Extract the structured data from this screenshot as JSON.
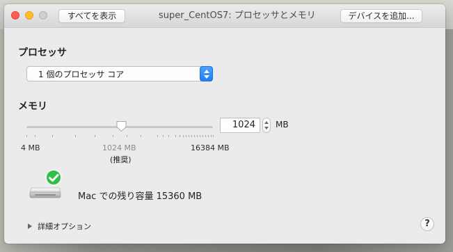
{
  "window": {
    "title": "super_CentOS7: プロセッサとメモリ"
  },
  "toolbar": {
    "show_all_label": "すべてを表示",
    "add_device_label": "デバイスを追加..."
  },
  "processor": {
    "heading": "プロセッサ",
    "selected_value": "1 個のプロセッサ コア"
  },
  "memory": {
    "heading": "メモリ",
    "value": "1024",
    "unit": "MB",
    "slider_level_fraction": 0.5,
    "min_label": "4 MB",
    "current_label": "1024 MB",
    "recommended_label": "(推奨)",
    "max_label": "16384 MB"
  },
  "status": {
    "capacity_text": "Mac での残り容量 15360 MB"
  },
  "details": {
    "label": "詳細オプション"
  },
  "help": {
    "label": "?"
  },
  "icons": {
    "select_stepper": "chevron-up-down-icon",
    "memory_stepper": "stepper-icon",
    "mac_icon": "mac-mini-icon",
    "check_icon": "check-icon",
    "disclosure_icon": "triangle-right-icon",
    "help_icon": "help-icon"
  },
  "colors": {
    "accent_blue": "#1f7ef3",
    "success_green": "#2fbe46",
    "window_bg": "#ebebeb"
  }
}
